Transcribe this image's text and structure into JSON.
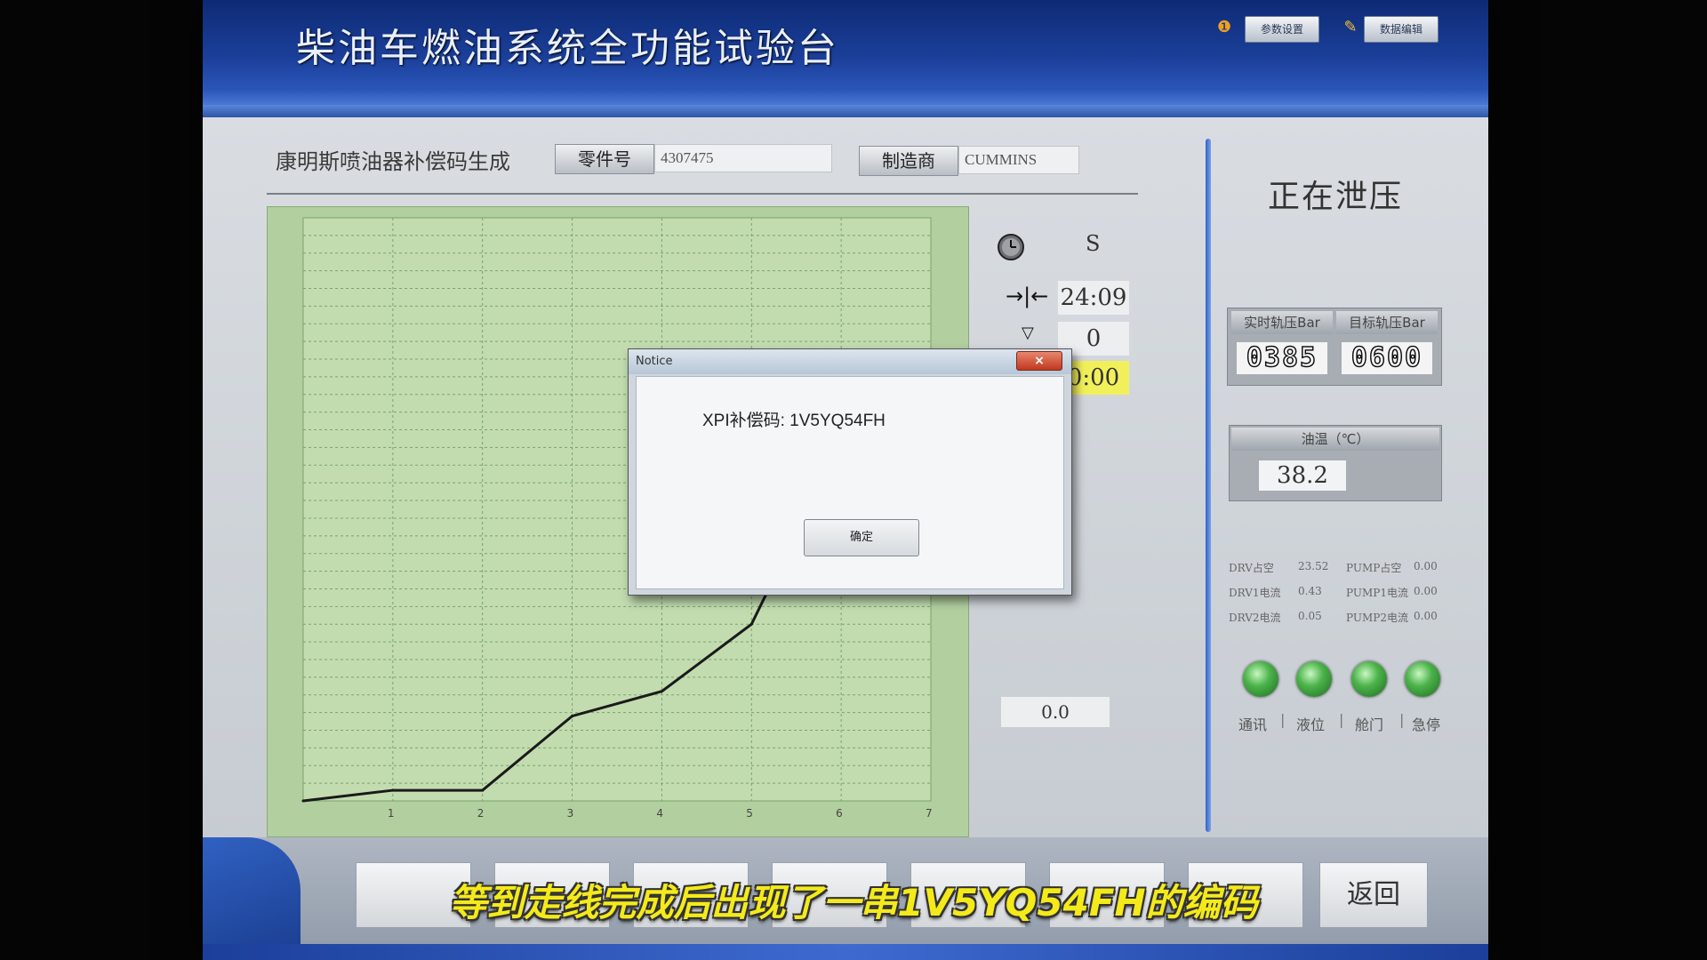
{
  "app": {
    "title": "柴油车燃油系统全功能试验台",
    "header_buttons": [
      "参数设置",
      "数据编辑"
    ]
  },
  "form": {
    "title": "康明斯喷油器补偿码生成",
    "part_no_label": "零件号",
    "part_no_value": "4307475",
    "maker_label": "制造商",
    "maker_value": "CUMMINS"
  },
  "readouts": {
    "unit": "S",
    "time": "24:09",
    "count": "0",
    "elapsed": "0:00",
    "bottom_value": "0.0"
  },
  "status": {
    "text": "正在泄压",
    "rail_actual_label": "实时轨压Bar",
    "rail_target_label": "目标轨压Bar",
    "rail_actual": "0385",
    "rail_target": "0600",
    "oil_temp_label": "油温（℃）",
    "oil_temp": "38.2",
    "stats": [
      {
        "label": "DRV占空",
        "value": "23.52"
      },
      {
        "label": "PUMP占空",
        "value": "0.00"
      },
      {
        "label": "DRV1电流",
        "value": "0.43"
      },
      {
        "label": "PUMP1电流",
        "value": "0.00"
      },
      {
        "label": "DRV2电流",
        "value": "0.05"
      },
      {
        "label": "PUMP2电流",
        "value": "0.00"
      }
    ],
    "indicators": [
      "通讯",
      "液位",
      "舱门",
      "急停"
    ],
    "indicator_color": "#4cb34a"
  },
  "toolbar": {
    "buttons": [
      "",
      "",
      "",
      "",
      "",
      "",
      "",
      "返回"
    ]
  },
  "dialog": {
    "title": "Notice",
    "close": "×",
    "message": "XPI补偿码: 1V5YQ54FH",
    "ok": "确定"
  },
  "subtitle": "等到走线完成后出现了一串1V5YQ54FH的编码",
  "chart_data": {
    "type": "line",
    "x": [
      0,
      1,
      2,
      3,
      4,
      5,
      6
    ],
    "values": [
      0,
      0.03,
      0.03,
      0.24,
      0.31,
      0.5,
      1.02
    ],
    "categories": [
      "1",
      "2",
      "3",
      "4",
      "5",
      "6",
      "7"
    ],
    "xlim": [
      0,
      7
    ],
    "ylim": [
      0,
      1.65
    ],
    "grid": true,
    "line_color": "#1a1a1a",
    "background": "#b2cf9f"
  }
}
